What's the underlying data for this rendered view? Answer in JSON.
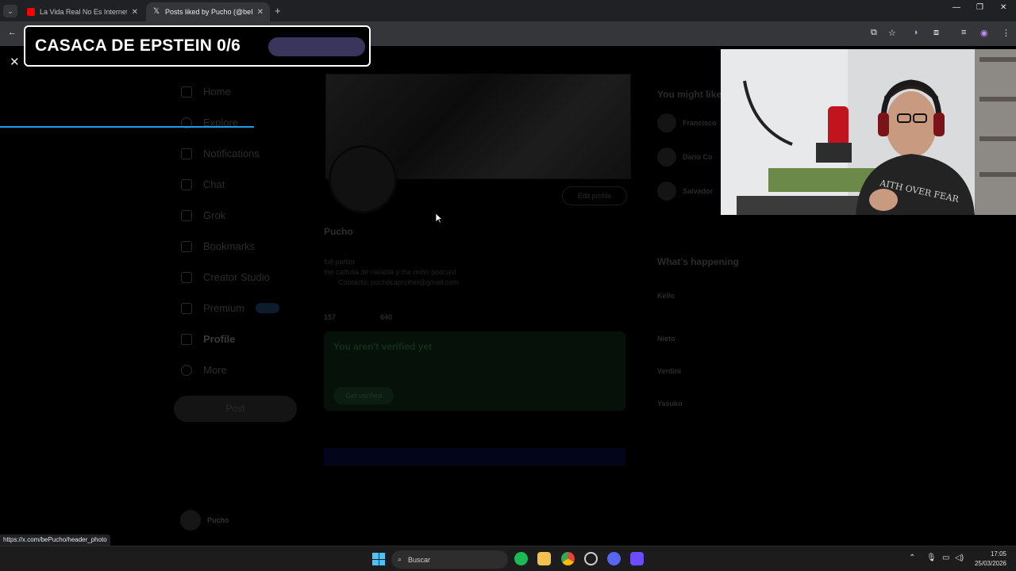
{
  "browser": {
    "tabs": [
      {
        "title": "La Vida Real No Es Internet - YouTube",
        "favicon": "youtube-icon"
      },
      {
        "title": "Posts liked by Pucho (@bePucho) / X",
        "favicon": "x-logo-icon"
      }
    ],
    "status_url": "https://x.com/bePucho/header_photo"
  },
  "overlay": {
    "banner_text": "CASACA DE EPSTEIN 0/6",
    "banner_progress": 0
  },
  "x_page": {
    "nav": [
      {
        "label": "Home",
        "icon": "home-icon"
      },
      {
        "label": "Explore",
        "icon": "search-icon"
      },
      {
        "label": "Notifications",
        "icon": "bell-icon"
      },
      {
        "label": "Chat",
        "icon": "mail-icon"
      },
      {
        "label": "Grok",
        "icon": "grok-icon"
      },
      {
        "label": "Bookmarks",
        "icon": "bookmark-icon"
      },
      {
        "label": "Creator Studio",
        "icon": "rocket-icon"
      },
      {
        "label": "Premium",
        "icon": "x-logo-icon"
      },
      {
        "label": "Profile",
        "icon": "person-icon"
      },
      {
        "label": "More",
        "icon": "more-icon"
      }
    ],
    "post_label": "Post",
    "me_name": "Pucho",
    "profile": {
      "name": "Pucho",
      "edit_label": "Edit profile",
      "bio_line1": "full-parlier",
      "bio_line2": "the cartulia de nalabia y the noho podcast",
      "bio_line3": "Contacto: puchocaprcihel@gmail.com",
      "following": "157",
      "followers": "640"
    },
    "verify": {
      "title": "You aren't verified yet",
      "button": "Get verified"
    },
    "right": {
      "might_like": "You might like",
      "suggestions": [
        "Francisco",
        "Darío Co",
        "Salvador"
      ],
      "happening": "What's happening",
      "trends": [
        "Kello",
        "Nieto",
        "Verdini",
        "Yasuko"
      ]
    }
  },
  "taskbar": {
    "search_placeholder": "Buscar",
    "time": "17:05",
    "date": "25/03/2026",
    "accent": "#4cc2ff"
  }
}
